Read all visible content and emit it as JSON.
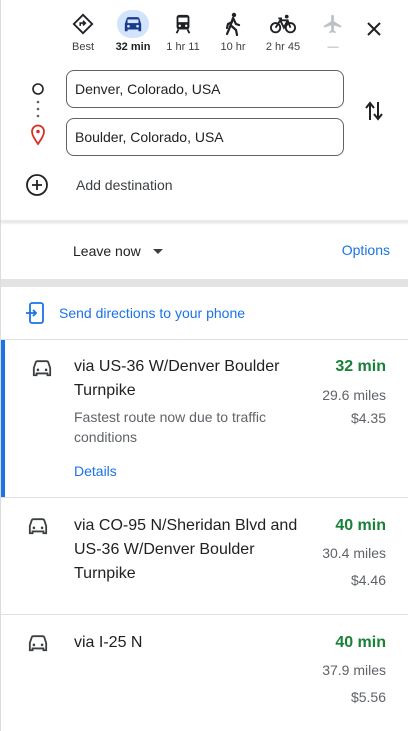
{
  "modes": [
    {
      "label": "Best",
      "icon": "diamond-directions-icon"
    },
    {
      "label": "32 min",
      "icon": "car-icon"
    },
    {
      "label": "1 hr 11",
      "icon": "train-icon"
    },
    {
      "label": "10 hr",
      "icon": "walking-icon"
    },
    {
      "label": "2 hr 45",
      "icon": "bicycle-icon"
    },
    {
      "label": "—",
      "icon": "airplane-icon"
    }
  ],
  "origin": {
    "value": "Denver, Colorado, USA"
  },
  "destination": {
    "value": "Boulder, Colorado, USA"
  },
  "add_destination": "Add destination",
  "leave_now": "Leave now",
  "options": "Options",
  "send_directions": "Send directions to your phone",
  "routes": [
    {
      "via": "via US-36 W/Denver Boulder Turnpike",
      "time": "32 min",
      "miles": "29.6 miles",
      "cost": "$4.35",
      "desc": "Fastest route now due to traffic conditions",
      "details": "Details"
    },
    {
      "via": "via CO-95 N/Sheridan Blvd and US-36 W/Denver Boulder Turnpike",
      "time": "40 min",
      "miles": "30.4 miles",
      "cost": "$4.46"
    },
    {
      "via": "via I-25 N",
      "time": "40 min",
      "miles": "37.9 miles",
      "cost": "$5.56"
    }
  ],
  "colors": {
    "accent": "#1a73e8",
    "time_green": "#188038",
    "origin_pin": "#d93025"
  }
}
